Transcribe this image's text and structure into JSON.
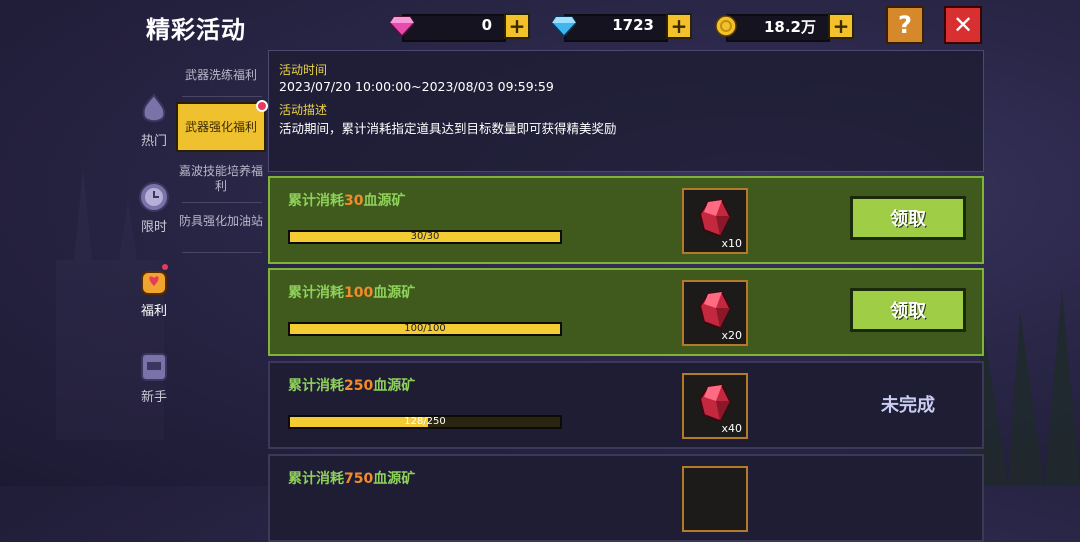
{
  "title": "精彩活动",
  "currencies": [
    {
      "name": "gem",
      "value": "0",
      "icon": "pink-gem-icon",
      "color": "#e84bb0"
    },
    {
      "name": "diamond",
      "value": "1723",
      "icon": "blue-diamond-icon",
      "color": "#3fb6f2"
    },
    {
      "name": "gold",
      "value": "18.2万",
      "icon": "gold-coin-icon",
      "color": "#f2c12b"
    }
  ],
  "buttons": {
    "help": "?",
    "close": "✕",
    "plus": "+"
  },
  "categories": [
    {
      "label": "热门",
      "icon": "hot-flame-icon"
    },
    {
      "label": "限时",
      "icon": "clock-icon"
    },
    {
      "label": "福利",
      "icon": "gift-bag-icon"
    },
    {
      "label": "新手",
      "icon": "novice-helmet-icon"
    }
  ],
  "submenu": [
    {
      "label": "武器洗练福利"
    },
    {
      "label": "武器强化福利"
    },
    {
      "label": "嘉波技能培养福利"
    },
    {
      "label": "防具强化加油站"
    }
  ],
  "info": {
    "time_heading": "活动时间",
    "time_value": "2023/07/20 10:00:00~2023/08/03 09:59:59",
    "desc_heading": "活动描述",
    "desc_value": "活动期间，累计消耗指定道具达到目标数量即可获得精美奖励"
  },
  "rewards": [
    {
      "prefix": "累计消耗",
      "num": "30",
      "suffix": "血源矿",
      "progress_text": "30/30",
      "progress": 1.0,
      "item_count": "x10",
      "action": "领取",
      "done": true
    },
    {
      "prefix": "累计消耗",
      "num": "100",
      "suffix": "血源矿",
      "progress_text": "100/100",
      "progress": 1.0,
      "item_count": "x20",
      "action": "领取",
      "done": true
    },
    {
      "prefix": "累计消耗",
      "num": "250",
      "suffix": "血源矿",
      "progress_text": "128/250",
      "progress": 0.512,
      "item_count": "x40",
      "action": "未完成",
      "done": false
    },
    {
      "prefix": "累计消耗",
      "num": "750",
      "suffix": "血源矿"
    }
  ]
}
